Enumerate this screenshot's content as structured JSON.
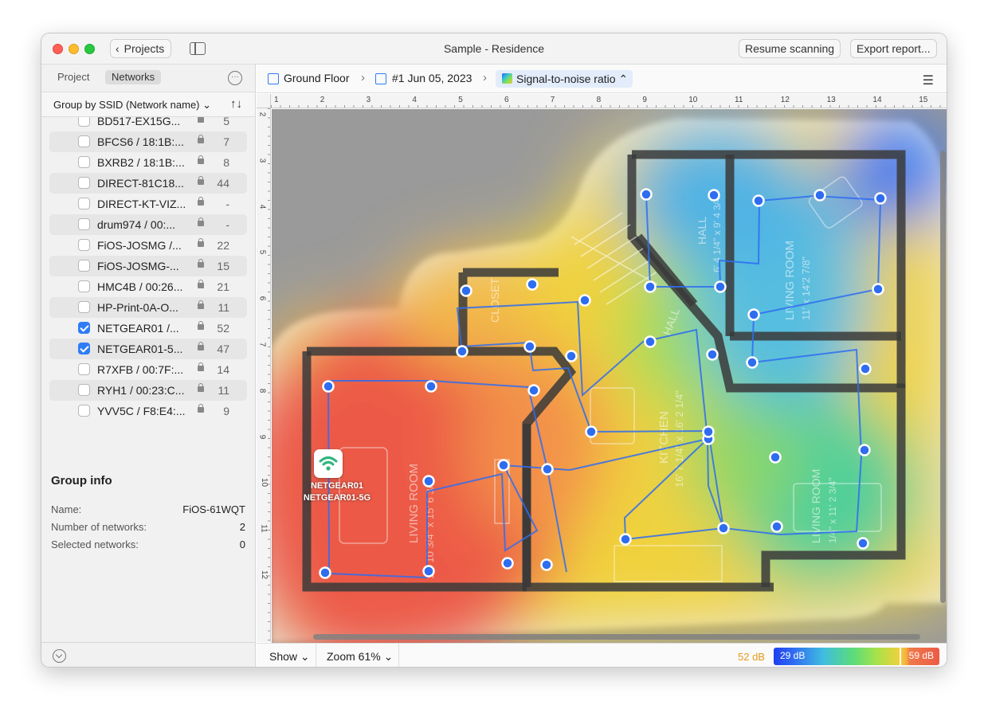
{
  "window": {
    "title": "Sample - Residence",
    "back_label": "Projects",
    "resume_label": "Resume scanning",
    "export_label": "Export report..."
  },
  "sidebar": {
    "tabs": [
      "Project",
      "Networks"
    ],
    "active_tab": "Networks",
    "group_by": "Group by SSID (Network name) ⌄",
    "networks": [
      {
        "name": "BD517-EX15G...",
        "count": "5",
        "checked": false
      },
      {
        "name": "BFCS6 / 18:1B:...",
        "count": "7",
        "checked": false
      },
      {
        "name": "BXRB2 / 18:1B:...",
        "count": "8",
        "checked": false
      },
      {
        "name": "DIRECT-81C18...",
        "count": "44",
        "checked": false
      },
      {
        "name": "DIRECT-KT-VIZ...",
        "count": "-",
        "checked": false
      },
      {
        "name": "drum974 / 00:...",
        "count": "-",
        "checked": false
      },
      {
        "name": "FiOS-JOSMG /...",
        "count": "22",
        "checked": false
      },
      {
        "name": "FiOS-JOSMG-...",
        "count": "15",
        "checked": false
      },
      {
        "name": "HMC4B / 00:26...",
        "count": "21",
        "checked": false
      },
      {
        "name": "HP-Print-0A-O...",
        "count": "11",
        "checked": false
      },
      {
        "name": "NETGEAR01 /...",
        "count": "52",
        "checked": true
      },
      {
        "name": "NETGEAR01-5...",
        "count": "47",
        "checked": true
      },
      {
        "name": "R7XFB / 00:7F:...",
        "count": "14",
        "checked": false
      },
      {
        "name": "RYH1 / 00:23:C...",
        "count": "11",
        "checked": false
      },
      {
        "name": "YVV5C / F8:E4:...",
        "count": "9",
        "checked": false
      }
    ],
    "group_info": {
      "title": "Group info",
      "name_label": "Name:",
      "name_value": "FiOS-61WQT",
      "count_label": "Number of networks:",
      "count_value": "2",
      "selected_label": "Selected networks:",
      "selected_value": "0"
    }
  },
  "breadcrumb": {
    "floor": "Ground Floor",
    "survey": "#1 Jun 05, 2023",
    "visualization": "Signal-to-noise ratio"
  },
  "ruler": {
    "top": [
      "1",
      "2",
      "3",
      "4",
      "5",
      "6",
      "7",
      "8",
      "9",
      "10",
      "11",
      "12",
      "13",
      "14",
      "15"
    ],
    "left": [
      "2",
      "3",
      "4",
      "5",
      "6",
      "7",
      "8",
      "9",
      "10",
      "11",
      "12"
    ]
  },
  "map": {
    "ap_label_1": "NETGEAR01",
    "ap_label_2": "NETGEAR01-5G",
    "room_labels": {
      "closet": "CLOSET",
      "hall_upper": "HALL",
      "hall_upper_dims": "6' 4 1/4\" x 9' 4 3/4\"",
      "hall_mid": "HALL",
      "living_right": "LIVING ROOM",
      "living_right_dims": "11' x 14'2 7/8\"",
      "living_left": "LIVING ROOM",
      "living_left_dims": "15' 10 3/4\" x 15' 6 3/4\"",
      "kitchen": "KITCHEN",
      "kitchen_dims": "16' 7 1/4\" x 16' 2 1/4\"",
      "living_br": "LIVING ROOM",
      "living_br_dims": "1/4\" x 11' 2 3/4\""
    }
  },
  "status": {
    "show": "Show",
    "zoom": "Zoom 61%",
    "legend_low": "52 dB",
    "legend_min": "29 dB",
    "legend_max": "59 dB"
  },
  "colors": {
    "accent": "#2f7cf6",
    "heat_red": "#ec5a46",
    "heat_blue": "#2f6cf2"
  }
}
